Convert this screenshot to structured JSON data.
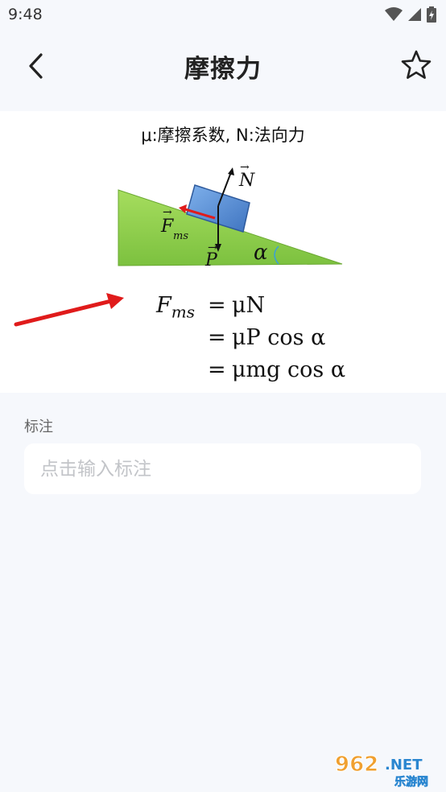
{
  "status_bar": {
    "time": "9:48"
  },
  "header": {
    "title": "摩擦力",
    "back_icon": "chevron-left-icon",
    "favorite_icon": "star-outline-icon"
  },
  "content": {
    "caption": "μ:摩擦系数, N:法向力",
    "diagram": {
      "label_N": "N",
      "label_F": "F",
      "label_F_sub": "ms",
      "label_P": "P",
      "label_angle": "α"
    },
    "formula": [
      {
        "lhs": "F",
        "lhs_sub": "ms",
        "eq": "=",
        "rhs": "μN"
      },
      {
        "lhs": "",
        "lhs_sub": "",
        "eq": "=",
        "rhs": "μP cos α"
      },
      {
        "lhs": "",
        "lhs_sub": "",
        "eq": "=",
        "rhs": "μmg cos α"
      }
    ]
  },
  "annotation": {
    "label": "标注",
    "placeholder": "点击输入标注"
  },
  "watermark": {
    "number": "962",
    "suffix": ".NET",
    "subtitle": "乐游网"
  },
  "colors": {
    "background": "#f6f8fc",
    "card": "#ffffff",
    "incline_green": "#8fd14f",
    "block_blue": "#5b8fd6",
    "arrow_red": "#e01b1b"
  }
}
